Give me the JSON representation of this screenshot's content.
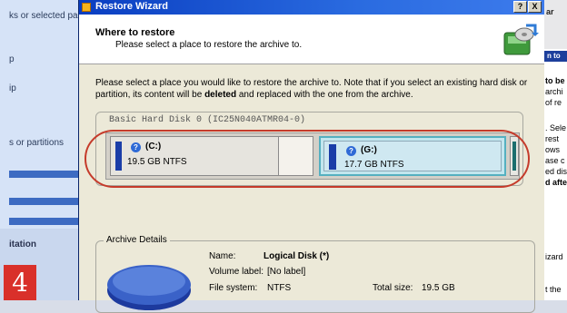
{
  "left_panel": {
    "texts": [
      {
        "text": "ks or selected par"
      },
      {
        "text": "p"
      },
      {
        "text": "ip"
      },
      {
        "text": "s or partitions"
      }
    ],
    "section_label": "itation",
    "step_number": "4"
  },
  "right_panel": {
    "top_text": "ar",
    "bar_text": "n to",
    "lines": [
      "to be",
      "archi",
      "of re",
      ". Sele",
      "rest",
      "ows",
      "ase c",
      "ed dis",
      "d afte",
      "izard",
      "t the"
    ]
  },
  "wizard": {
    "title": "Restore Wizard",
    "help_button": "?",
    "close_button": "X",
    "header": {
      "title": "Where to restore",
      "subtitle": "Please select a place to restore the archive to."
    },
    "instructions": {
      "part1": "Please select a place you would like to restore the archive to. Note that if you select an existing hard disk or partition, its content will be ",
      "bold": "deleted",
      "part2": " and replaced with the one from the archive."
    },
    "disk": {
      "title": "Basic Hard Disk 0 (IC25N040ATMR04-0)",
      "partitions": [
        {
          "letter": "(C:)",
          "size": "19.5 GB NTFS"
        },
        {
          "letter": "(G:)",
          "size": "17.7 GB NTFS"
        }
      ]
    },
    "archive_details": {
      "legend": "Archive Details",
      "name_label": "Name:",
      "name_value": "Logical Disk (*)",
      "volume_label": "Volume label:",
      "volume_value": "[No label]",
      "fs_label": "File system:",
      "fs_value": "NTFS",
      "total_label": "Total size:",
      "total_value": "19.5 GB"
    }
  },
  "colors": {
    "title_bar": "#0a3ec1",
    "highlight_ring": "#c53b2b",
    "partition_fill": "#1a3da8",
    "selected_partition": "#c3e6ee",
    "step_badge": "#d9302a"
  }
}
